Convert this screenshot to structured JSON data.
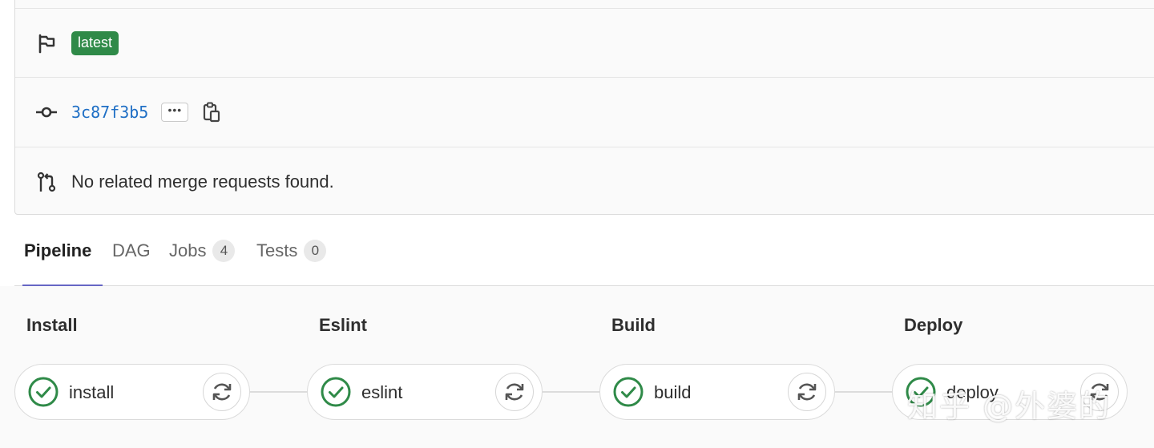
{
  "info": {
    "tag_badge": "latest",
    "commit_sha": "3c87f3b5",
    "ellipsis_label": "•••",
    "merge_requests_text": "No related merge requests found."
  },
  "tabs": [
    {
      "label": "Pipeline",
      "count": null,
      "active": true
    },
    {
      "label": "DAG",
      "count": null,
      "active": false
    },
    {
      "label": "Jobs",
      "count": "4",
      "active": false
    },
    {
      "label": "Tests",
      "count": "0",
      "active": false
    }
  ],
  "stages": [
    {
      "title": "Install",
      "job": "install",
      "status": "passed"
    },
    {
      "title": "Eslint",
      "job": "eslint",
      "status": "passed"
    },
    {
      "title": "Build",
      "job": "build",
      "status": "passed"
    },
    {
      "title": "Deploy",
      "job": "deploy",
      "status": "passed"
    }
  ],
  "watermark": "知乎 @外婆的",
  "colors": {
    "badge_green": "#2f8a48",
    "sha_blue": "#1f6fc5",
    "status_green": "#2f8a48",
    "active_tab_underline": "#6666c4"
  },
  "icons": {
    "tag": "flag-icon",
    "commit": "commit-icon",
    "copy": "clipboard-icon",
    "merge_request": "merge-request-icon",
    "status": "status-success-icon",
    "retry": "retry-icon"
  }
}
